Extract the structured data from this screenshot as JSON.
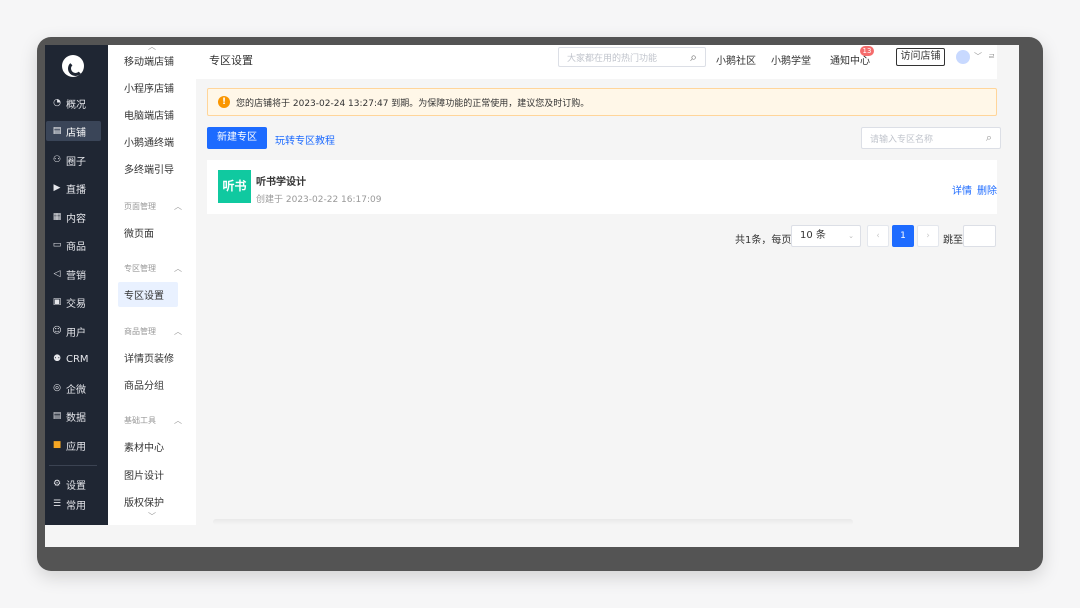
{
  "nav": {
    "items": [
      {
        "icon": "◔",
        "label": "概况"
      },
      {
        "icon": "▤",
        "label": "店铺"
      },
      {
        "icon": "⚇",
        "label": "圈子"
      },
      {
        "icon": "▶",
        "label": "直播"
      },
      {
        "icon": "▦",
        "label": "内容"
      },
      {
        "icon": "▭",
        "label": "商品"
      },
      {
        "icon": "◁",
        "label": "营销"
      },
      {
        "icon": "▣",
        "label": "交易"
      },
      {
        "icon": "☺",
        "label": "用户"
      },
      {
        "icon": "⚉",
        "label": "CRM"
      },
      {
        "icon": "◎",
        "label": "企微"
      },
      {
        "icon": "▤",
        "label": "数据"
      },
      {
        "icon": "■",
        "label": "应用"
      }
    ],
    "settings": {
      "icon": "⚙",
      "label": "设置"
    },
    "common": {
      "icon": "☰",
      "label": "常用"
    }
  },
  "sub": {
    "up": "︿",
    "down": "﹀",
    "items_top": [
      "移动端店铺",
      "小程序店铺",
      "电脑端店铺",
      "小鹅通终端",
      "多终端引导"
    ],
    "group_page": "页面管理",
    "item_micro": "微页面",
    "group_zone": "专区管理",
    "item_zone": "专区设置",
    "group_goods": "商品管理",
    "item_detail": "详情页装修",
    "item_group": "商品分组",
    "group_tools": "基础工具",
    "item_material": "素材中心",
    "item_picture": "图片设计",
    "item_copyright": "版权保护",
    "caret": "︿"
  },
  "header": {
    "title": "专区设置",
    "search_placeholder": "大家都在用的热门功能",
    "search_icon": "⌕",
    "links": [
      "小鹅社区",
      "小鹅学堂",
      "通知中心"
    ],
    "badge": "13",
    "visit": "访问店铺",
    "caret": "﹀",
    "more": "ㄹ"
  },
  "notice": {
    "icon": "!",
    "text": "您的店铺将于 2023-02-24 13:27:47 到期。为保障功能的正常使用，建议您及时订购。"
  },
  "toolbar": {
    "new_label": "新建专区",
    "tutorial_label": "玩转专区教程",
    "search_placeholder": "请输入专区名称",
    "search_icon": "⌕"
  },
  "card": {
    "thumb_text": "听书",
    "title": "听书学设计",
    "date": "创建于 2023-02-22 16:17:09",
    "detail": "详情",
    "delete": "删除"
  },
  "pager": {
    "total": "共1条，每页",
    "size": "10 条",
    "size_caret": "⌄",
    "prev": "‹",
    "current": "1",
    "next": "›",
    "jump": "跳至"
  }
}
